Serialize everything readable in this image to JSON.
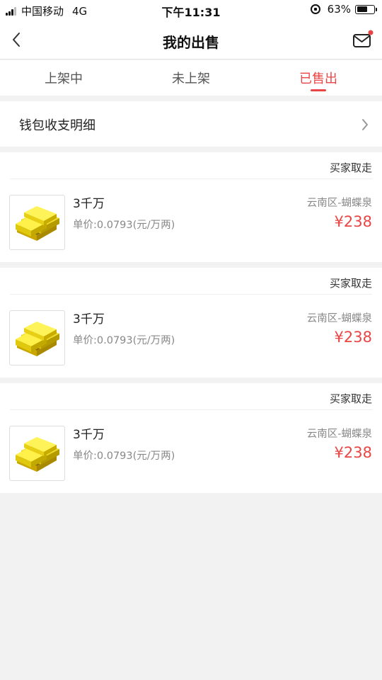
{
  "status_bar": {
    "carrier": "中国移动",
    "network": "4G",
    "time": "下午11:31",
    "battery_percent": "63%",
    "battery_level": 0.63
  },
  "nav": {
    "title": "我的出售",
    "back_icon": "chevron-left-icon",
    "mail_icon": "mail-icon",
    "mail_badge_color": "#e94545"
  },
  "tabs": [
    {
      "label": "上架中",
      "active": false
    },
    {
      "label": "未上架",
      "active": false
    },
    {
      "label": "已售出",
      "active": true
    }
  ],
  "accent_color": "#e94545",
  "wallet": {
    "label": "钱包收支明细"
  },
  "orders": [
    {
      "status": "买家取走",
      "title": "3千万",
      "unit_price": "单价:0.0793(元/万两)",
      "server": "云南区-蝴蝶泉",
      "price": "¥238",
      "thumb_icon": "gold-bars-icon"
    },
    {
      "status": "买家取走",
      "title": "3千万",
      "unit_price": "单价:0.0793(元/万两)",
      "server": "云南区-蝴蝶泉",
      "price": "¥238",
      "thumb_icon": "gold-bars-icon"
    },
    {
      "status": "买家取走",
      "title": "3千万",
      "unit_price": "单价:0.0793(元/万两)",
      "server": "云南区-蝴蝶泉",
      "price": "¥238",
      "thumb_icon": "gold-bars-icon"
    }
  ]
}
